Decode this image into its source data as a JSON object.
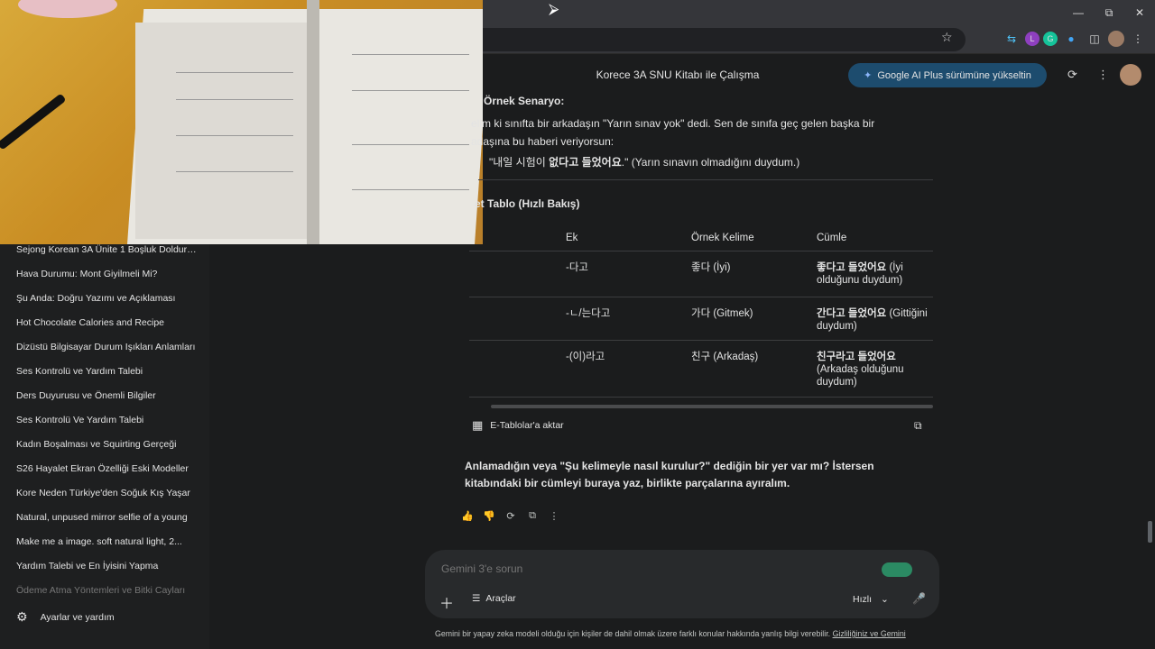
{
  "header": {
    "title": "Korece 3A SNU Kitabı ile Çalışma",
    "upgrade_label": "Google AI Plus sürümüne yükseltin"
  },
  "sidebar": {
    "items": [
      "Sejong Korean 3A Ünite 1 Boşluk Doldurma",
      "Hava Durumu: Mont Giyilmeli Mi?",
      "Şu Anda: Doğru Yazımı ve Açıklaması",
      "Hot Chocolate Calories and Recipe",
      "Dizüstü Bilgisayar Durum Işıkları Anlamları",
      "Ses Kontrolü ve Yardım Talebi",
      "Ders Duyurusu ve Önemli Bilgiler",
      "Ses Kontrolü Ve Yardım Talebi",
      "Kadın Boşalması ve Squirting Gerçeği",
      "S26 Hayalet Ekran Özelliği Eski Modeller",
      "Kore Neden Türkiye'den Soğuk Kış Yaşar",
      "Natural, unpused mirror selfie of a young",
      "Make me a image. soft natural light, 2...",
      "Yardım Talebi ve En İyisini Yapma",
      "Ödeme Atma Yöntemleri ve Bitki Cayları"
    ],
    "settings_label": "Ayarlar ve yardım"
  },
  "response": {
    "scenario_heading": "Örnek Senaryo:",
    "scenario_text": "elim ki sınıfta bir arkadaşın \"Yarın sınav yok\" dedi. Sen de sınıfa geç gelen başka bir adaşına bu haberi veriyorsun:",
    "quote_pre": "\"내일 시험이 ",
    "quote_bold": "없다고 들었어요",
    "quote_post": ".\" (Yarın sınavın olmadığını duydum.)",
    "table_heading": "et Tablo (Hızlı Bakış)",
    "table": {
      "headers": [
        "Ek",
        "Örnek Kelime",
        "Cümle"
      ],
      "rows": [
        {
          "ek": "-다고",
          "word": "좋다 (İyi)",
          "sentence_bold": "좋다고 들었어요",
          "sentence_rest": " (İyi olduğunu duydum)"
        },
        {
          "ek": "-ㄴ/는다고",
          "word": "가다 (Gitmek)",
          "sentence_bold": "간다고 들었어요",
          "sentence_rest": " (Gittiğini duydum)"
        },
        {
          "ek": "-(이)라고",
          "word": "친구 (Arkadaş)",
          "sentence_bold": "친구라고 들었어요",
          "sentence_rest": " (Arkadaş olduğunu duydum)"
        }
      ]
    },
    "export_label": "E-Tablolar'a aktar",
    "followup": "Anlamadığın veya \"Şu kelimeyle nasıl kurulur?\" dediğin bir yer var mı? İstersen kitabındaki bir cümleyi buraya yaz, birlikte parçalarına ayıralım."
  },
  "prompt": {
    "placeholder": "Gemini 3'e sorun",
    "tools_label": "Araçlar",
    "mode_label": "Hızlı"
  },
  "footer": {
    "disclaimer": "Gemini bir yapay zeka modeli olduğu için kişiler de dahil olmak üzere farklı konular hakkında yanlış bilgi verebilir.",
    "privacy_link": "Gizliliğiniz ve Gemini"
  },
  "colors": {
    "background": "#1b1c1d",
    "sidebar": "#1e1f20",
    "upgrade_button": "#1d4c6e",
    "prompt_box": "#282a2c"
  }
}
